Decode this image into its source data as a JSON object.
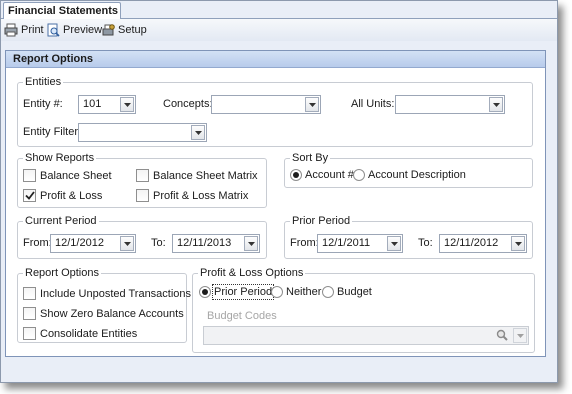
{
  "tab": {
    "label": "Financial Statements"
  },
  "toolbar": {
    "print": "Print",
    "preview": "Preview",
    "setup": "Setup"
  },
  "panel": {
    "title": "Report Options"
  },
  "entities": {
    "legend": "Entities",
    "entity_label": "Entity #:",
    "entity_value": "101",
    "concepts_label": "Concepts:",
    "concepts_value": "",
    "all_units_label": "All Units:",
    "all_units_value": "",
    "filter_label": "Entity Filter:",
    "filter_value": ""
  },
  "show_reports": {
    "legend": "Show Reports",
    "items": [
      {
        "label": "Balance Sheet",
        "checked": false
      },
      {
        "label": "Balance Sheet Matrix",
        "checked": false
      },
      {
        "label": "Profit & Loss",
        "checked": true
      },
      {
        "label": "Profit & Loss Matrix",
        "checked": false
      }
    ]
  },
  "sort_by": {
    "legend": "Sort By",
    "options": [
      {
        "label": "Account #",
        "selected": true
      },
      {
        "label": "Account Description",
        "selected": false
      }
    ]
  },
  "current_period": {
    "legend": "Current Period",
    "from_label": "From:",
    "from_value": "12/1/2012",
    "to_label": "To:",
    "to_value": "12/11/2013"
  },
  "prior_period": {
    "legend": "Prior Period",
    "from_label": "From:",
    "from_value": "12/1/2011",
    "to_label": "To:",
    "to_value": "12/11/2012"
  },
  "report_options": {
    "legend": "Report Options",
    "items": [
      {
        "label": "Include Unposted Transactions",
        "checked": false
      },
      {
        "label": "Show Zero Balance Accounts",
        "checked": false
      },
      {
        "label": "Consolidate Entities",
        "checked": false
      }
    ]
  },
  "pl_options": {
    "legend": "Profit & Loss Options",
    "options": [
      {
        "label": "Prior Period",
        "selected": true
      },
      {
        "label": "Neither",
        "selected": false
      },
      {
        "label": "Budget",
        "selected": false
      }
    ],
    "budget_codes_label": "Budget Codes",
    "budget_codes_value": ""
  },
  "icons": {
    "print": "printer-icon",
    "preview": "preview-icon",
    "setup": "setup-icon",
    "dropdown": "chevron-down-icon",
    "search": "search-icon"
  }
}
